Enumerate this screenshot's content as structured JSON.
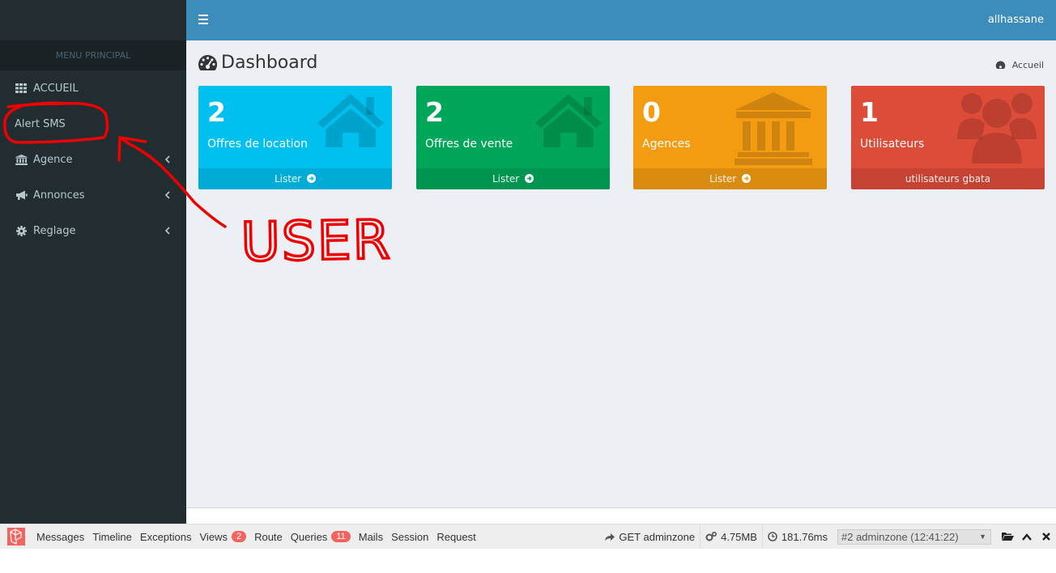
{
  "header": {
    "user": "allhassane"
  },
  "sidebar": {
    "section_title": "MENU PRINCIPAL",
    "items": [
      {
        "label": "ACCUEIL",
        "icon": "grid-icon"
      },
      {
        "label": "Alert SMS"
      },
      {
        "label": "Agence",
        "icon": "bank-icon"
      },
      {
        "label": "Annonces",
        "icon": "bullhorn-icon"
      },
      {
        "label": "Reglage",
        "icon": "gear-icon"
      }
    ]
  },
  "page": {
    "title": "Dashboard",
    "breadcrumb": "Accueil"
  },
  "boxes": [
    {
      "value": "2",
      "label": "Offres de location",
      "footer": "Lister",
      "color": "#00c0ef",
      "icon": "home-icon"
    },
    {
      "value": "2",
      "label": "Offres de vente",
      "footer": "Lister",
      "color": "#00a65a",
      "icon": "home-icon"
    },
    {
      "value": "0",
      "label": "Agences",
      "footer": "Lister",
      "color": "#f39c12",
      "icon": "bank-icon"
    },
    {
      "value": "1",
      "label": "Utilisateurs",
      "footer": "utilisateurs gbata",
      "color": "#dd4b39",
      "icon": "users-icon"
    }
  ],
  "annotation": {
    "text": "USER",
    "color": "#ee0000"
  },
  "debugbar": {
    "tabs": [
      {
        "label": "Messages"
      },
      {
        "label": "Timeline"
      },
      {
        "label": "Exceptions"
      },
      {
        "label": "Views",
        "badge": "2"
      },
      {
        "label": "Route"
      },
      {
        "label": "Queries",
        "badge": "11"
      },
      {
        "label": "Mails"
      },
      {
        "label": "Session"
      },
      {
        "label": "Request"
      }
    ],
    "method": "GET adminzone",
    "memory": "4.75MB",
    "time": "181.76ms",
    "request_select": "#2 adminzone (12:41:22)"
  }
}
